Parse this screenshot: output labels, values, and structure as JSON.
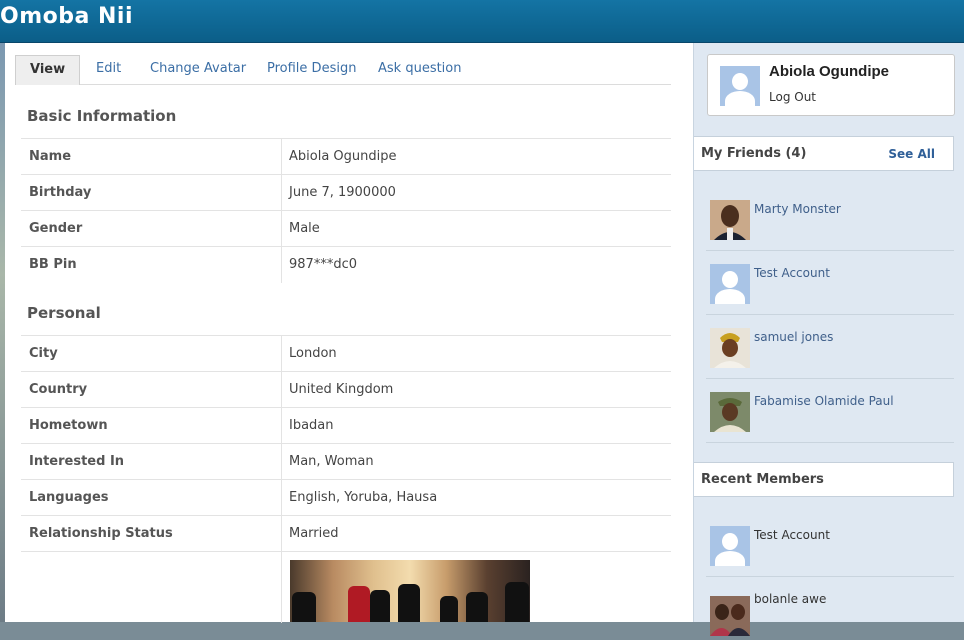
{
  "header": {
    "brand": "Omoba Nii"
  },
  "tabs": [
    {
      "label": "View"
    },
    {
      "label": "Edit"
    },
    {
      "label": "Change Avatar"
    },
    {
      "label": "Profile Design"
    },
    {
      "label": "Ask question"
    }
  ],
  "basic": {
    "title": "Basic Information",
    "rows": [
      {
        "label": "Name",
        "value": "Abiola Ogundipe"
      },
      {
        "label": "Birthday",
        "value": "June 7, 1900000"
      },
      {
        "label": "Gender",
        "value": "Male"
      },
      {
        "label": "BB Pin",
        "value": "987***dc0"
      }
    ]
  },
  "personal": {
    "title": "Personal",
    "rows": [
      {
        "label": "City",
        "value": "London"
      },
      {
        "label": "Country",
        "value": "United Kingdom"
      },
      {
        "label": "Hometown",
        "value": "Ibadan"
      },
      {
        "label": "Interested In",
        "value": "Man, Woman"
      },
      {
        "label": "Languages",
        "value": "English, Yoruba, Hausa"
      },
      {
        "label": "Relationship Status",
        "value": "Married"
      }
    ]
  },
  "user": {
    "name": "Abiola Ogundipe",
    "logout": "Log Out"
  },
  "friends": {
    "title": "My Friends (4)",
    "see_all": "See All",
    "items": [
      {
        "name": "Marty Monster"
      },
      {
        "name": "Test Account"
      },
      {
        "name": "samuel jones"
      },
      {
        "name": "Fabamise Olamide Paul"
      }
    ]
  },
  "recent": {
    "title": "Recent Members",
    "items": [
      {
        "name": "Test Account"
      },
      {
        "name": "bolanle awe"
      }
    ]
  },
  "colors": {
    "header": "#0d6593",
    "link": "#3b6ea5",
    "sidebar": "#dfe8f2"
  }
}
